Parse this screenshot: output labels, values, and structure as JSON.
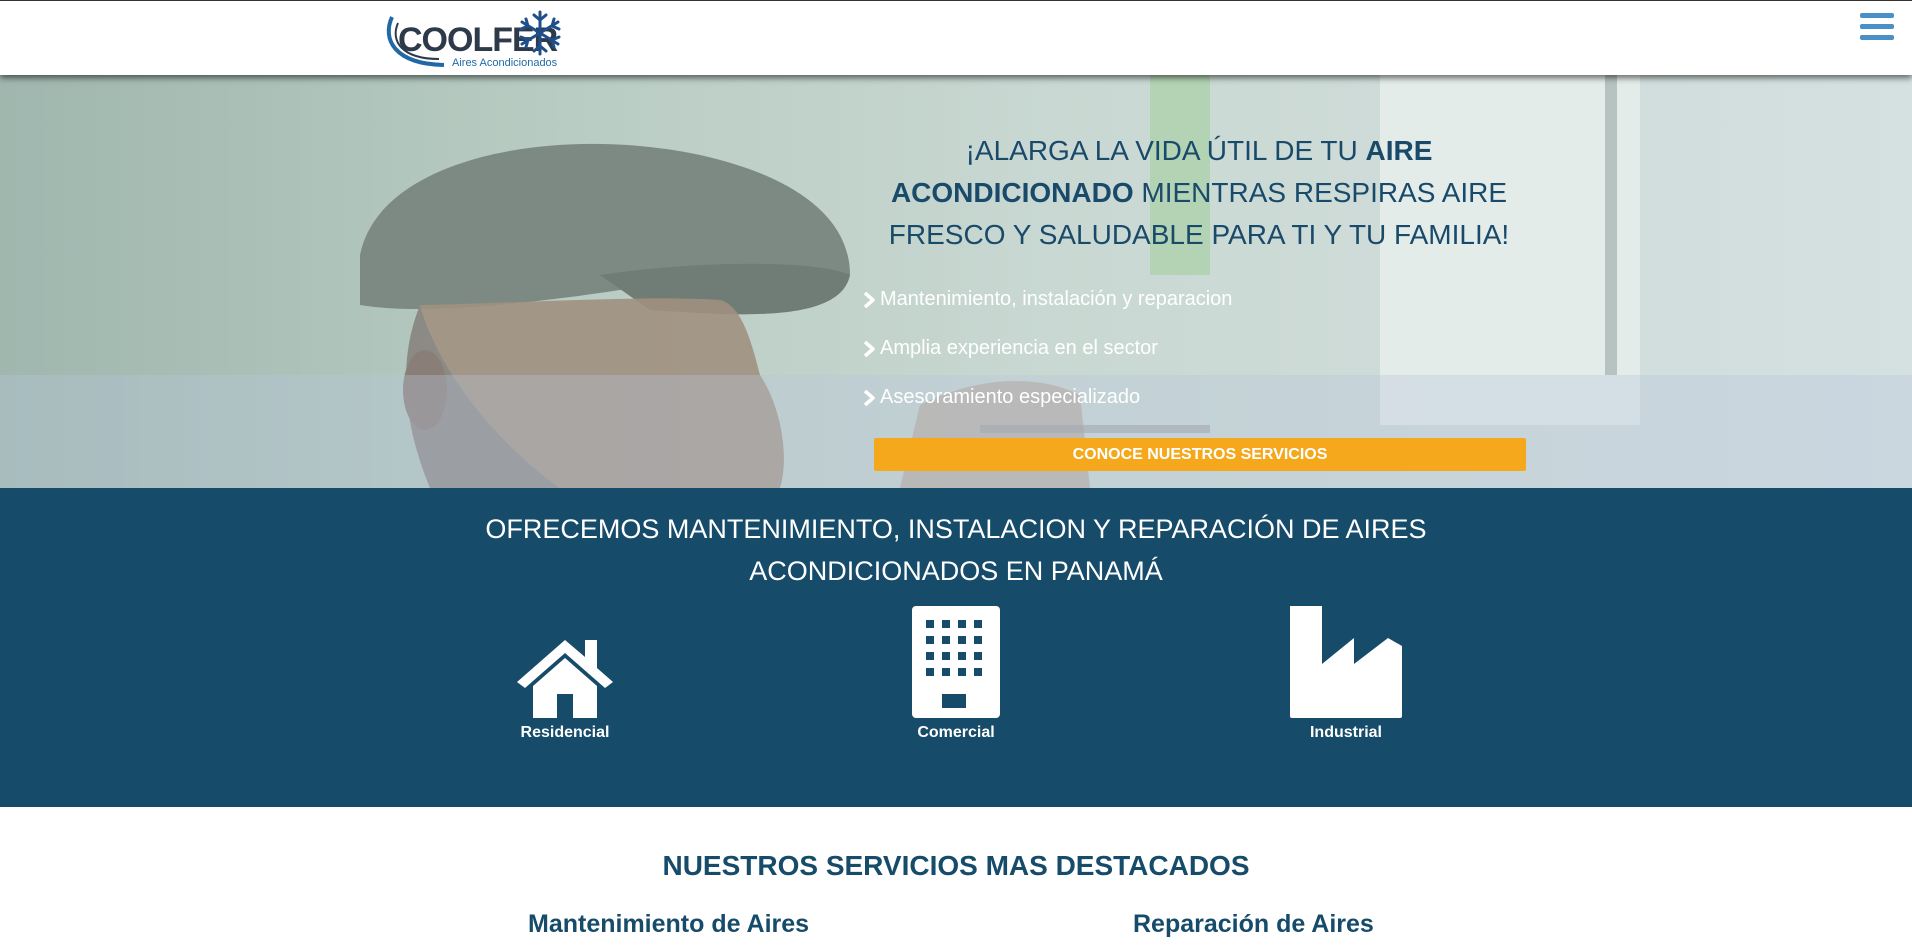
{
  "header": {
    "logo": {
      "wordmark": "COOLFER",
      "tagline": "Aires Acondicionados"
    },
    "menu_icon": "hamburger-menu-icon"
  },
  "hero": {
    "title_part1": "¡ALARGA LA VIDA ÚTIL DE TU ",
    "title_bold": "AIRE ACONDICIONADO",
    "title_part2": " MIENTRAS RESPIRAS AIRE FRESCO Y SALUDABLE PARA TI Y TU FAMILIA!",
    "features": [
      "Mantenimiento, instalación y reparacion",
      "Amplia experiencia en el sector",
      "Asesoramiento especializado"
    ],
    "cta_label": "CONOCE NUESTROS SERVICIOS"
  },
  "services_band": {
    "title": "OFRECEMOS MANTENIMIENTO, INSTALACION Y REPARACIÓN DE AIRES ACONDICIONADOS EN PANAMÁ",
    "tiles": [
      {
        "label": "Residencial",
        "icon": "house-icon"
      },
      {
        "label": "Comercial",
        "icon": "building-icon"
      },
      {
        "label": "Industrial",
        "icon": "factory-icon"
      }
    ]
  },
  "featured": {
    "title": "NUESTROS SERVICIOS MAS DESTACADOS",
    "columns": [
      "Mantenimiento de Aires",
      "Reparación de Aires"
    ]
  },
  "colors": {
    "brand_dark": "#164b6a",
    "accent": "#f5a81c",
    "menu": "#4a90c8"
  }
}
